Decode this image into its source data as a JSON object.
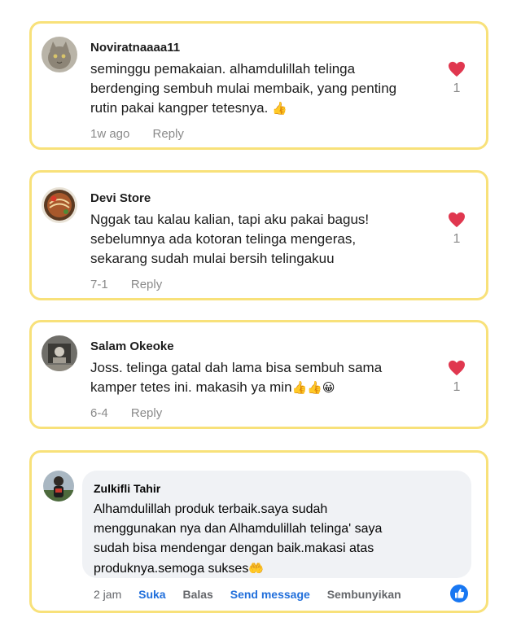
{
  "colors": {
    "card_border": "#f8e17a",
    "heart": "#e0374f",
    "muted": "#8a8a8a",
    "fb_blue": "#216fdb"
  },
  "comments": [
    {
      "author": "Noviratnaaaa11",
      "avatar_icon": "cat-avatar-icon",
      "text": "seminggu pemakaian. alhamdulillah telinga\nberdenging sembuh mulai membaik, yang penting\nrutin pakai kangper tetesnya.",
      "emoji": "👍",
      "time": "1w ago",
      "reply_label": "Reply",
      "like_count": "1"
    },
    {
      "author": "Devi Store",
      "avatar_icon": "food-avatar-icon",
      "text": "Nggak tau kalau kalian, tapi aku pakai bagus!\nsebelumnya ada kotoran telinga mengeras,\nsekarang sudah mulai bersih telingakuu",
      "emoji": "",
      "time": "7-1",
      "reply_label": "Reply",
      "like_count": "1"
    },
    {
      "author": "Salam Okeoke",
      "avatar_icon": "photo-avatar-icon",
      "text": "Joss. telinga gatal dah lama bisa sembuh sama\nkamper tetes ini. makasih ya min",
      "emoji": "👍👍😀",
      "time": "6-4",
      "reply_label": "Reply",
      "like_count": "1"
    }
  ],
  "fb_comment": {
    "author": "Zulkifli Tahir",
    "avatar_icon": "person-avatar-icon",
    "text": "Alhamdulillah produk terbaik.saya sudah\nmenggunakan nya dan Alhamdulillah telinga' saya\nsudah bisa mendengar dengan baik.makasi atas\nproduknya.semoga sukses",
    "emoji": "🤲",
    "time": "2 jam",
    "like_label": "Suka",
    "reply_label": "Balas",
    "send_label": "Send message",
    "hide_label": "Sembunyikan",
    "reaction_icon": "thumbs-up-icon"
  }
}
